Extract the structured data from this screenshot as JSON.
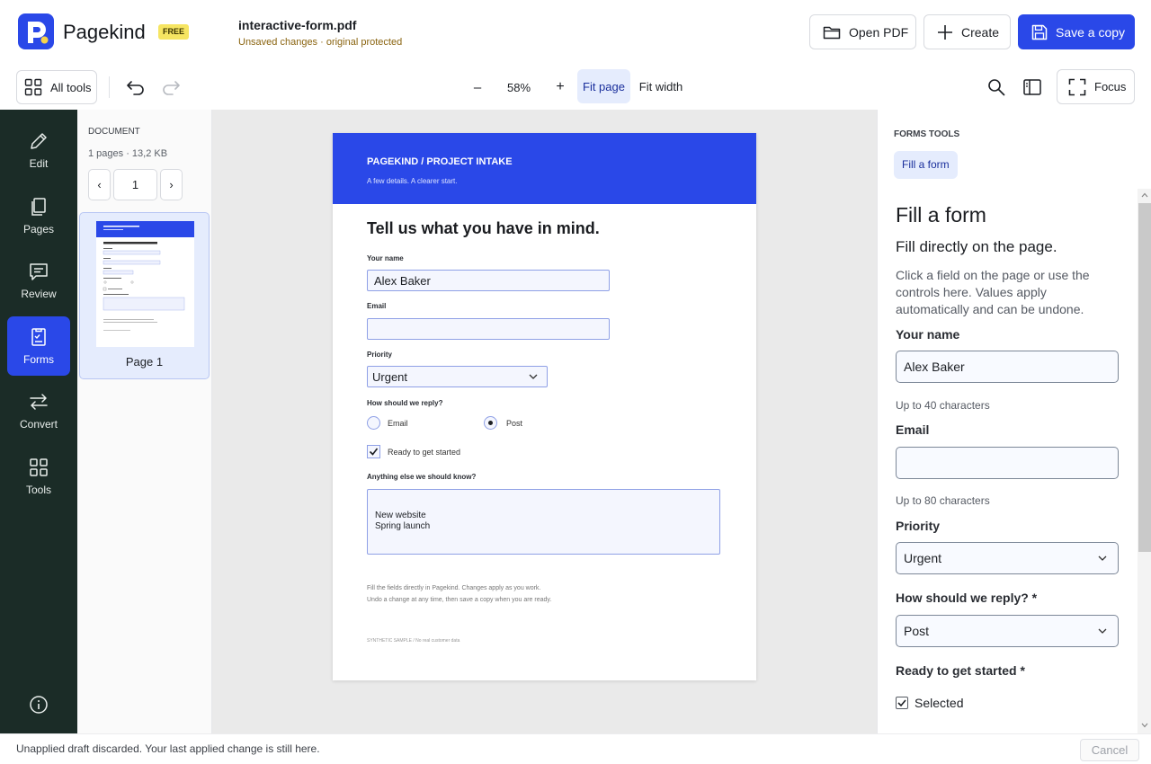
{
  "app": {
    "brand": "Pagekind",
    "plan_badge": "FREE",
    "file_name": "interactive-form.pdf",
    "file_status": "Unsaved changes · original protected",
    "open_pdf": "Open PDF",
    "create": "Create",
    "save_copy": "Save a copy"
  },
  "toolbar": {
    "all_tools": "All tools",
    "zoom_out": "–",
    "zoom_level": "58%",
    "zoom_in": "+",
    "fit_page": "Fit page",
    "fit_width": "Fit width",
    "focus": "Focus"
  },
  "rail": {
    "edit": "Edit",
    "pages": "Pages",
    "review": "Review",
    "forms": "Forms",
    "convert": "Convert",
    "tools": "Tools"
  },
  "thumbnails": {
    "heading": "DOCUMENT",
    "meta": "1 pages · 13,2 KB",
    "prev": "‹",
    "page_number": "1",
    "next": "›",
    "page_label": "Page 1"
  },
  "page": {
    "header_title": "PAGEKIND / PROJECT INTAKE",
    "header_sub": "A few details. A clearer start.",
    "heading": "Tell us what you have in mind.",
    "name_label": "Your name",
    "name_value": "Alex Baker",
    "email_label": "Email",
    "email_value": "",
    "priority_label": "Priority",
    "priority_value": "Urgent",
    "reply_label": "How should we reply?",
    "reply_email": "Email",
    "reply_post": "Post",
    "ready_label": "Ready to get started",
    "notes_label": "Anything else we should know?",
    "notes_line1": "New website",
    "notes_line2": "Spring launch",
    "footer1": "Fill the fields directly in Pagekind. Changes apply as you work.",
    "footer2": "Undo a change at any time, then save a copy when you are ready.",
    "footer3": "SYNTHETIC SAMPLE  /  No real customer data"
  },
  "panel": {
    "section": "FORMS TOOLS",
    "chip": "Fill a form",
    "title": "Fill a form",
    "subtitle": "Fill directly on the page.",
    "description": "Click a field on the page or use the controls here. Values apply automatically and can be undone.",
    "name_label": "Your name",
    "name_value": "Alex Baker",
    "name_hint": "Up to 40 characters",
    "email_label": "Email",
    "email_value": "",
    "email_hint": "Up to 80 characters",
    "priority_label": "Priority",
    "priority_value": "Urgent",
    "reply_label": "How should we reply? *",
    "reply_value": "Post",
    "ready_label": "Ready to get started *",
    "ready_checkbox_label": "Selected"
  },
  "status_bar": {
    "message": "Unapplied draft discarded. Your last applied change is still here.",
    "cancel": "Cancel"
  },
  "colors": {
    "accent": "#2a48e8",
    "rail": "#1b2c27",
    "badge": "#f6e562",
    "status_warning": "#8a6410"
  }
}
